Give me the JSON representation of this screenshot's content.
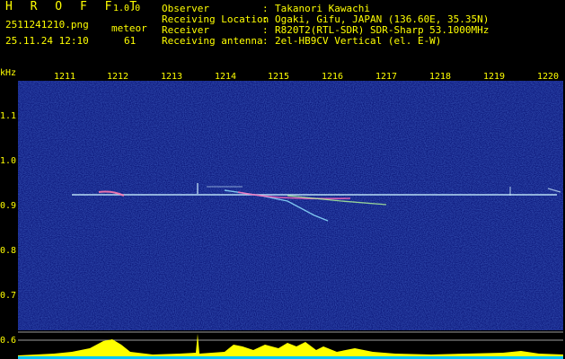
{
  "header": {
    "brand": "H R O F F T",
    "version": "1.0.0",
    "filename": "2511241210.png",
    "mode_label": "meteor",
    "datetime": "25.11.24 12:10",
    "count": "61",
    "info": [
      {
        "label": "Observer",
        "value": "Takanori Kawachi"
      },
      {
        "label": "Receiving Location",
        "value": "Ogaki, Gifu, JAPAN (136.60E, 35.35N)"
      },
      {
        "label": "Receiver",
        "value": "R820T2(RTL-SDR) SDR-Sharp 53.1000MHz"
      },
      {
        "label": "Receiving antenna",
        "value": "2el-HB9CV Vertical (el. E-W)"
      }
    ]
  },
  "axes": {
    "unit": "kHz",
    "x_ticks": [
      "1211",
      "1212",
      "1213",
      "1214",
      "1215",
      "1216",
      "1217",
      "1218",
      "1219",
      "1220"
    ],
    "y_ticks": [
      "1.1",
      "1.0",
      "0.9",
      "0.8",
      "0.7",
      "0.6"
    ]
  },
  "colors": {
    "background": "#0a1478",
    "text": "#ffff00",
    "signal": "#c8f0ff",
    "bottom_fill": "#ffff00",
    "bottom_base": "#00c8ff"
  }
}
